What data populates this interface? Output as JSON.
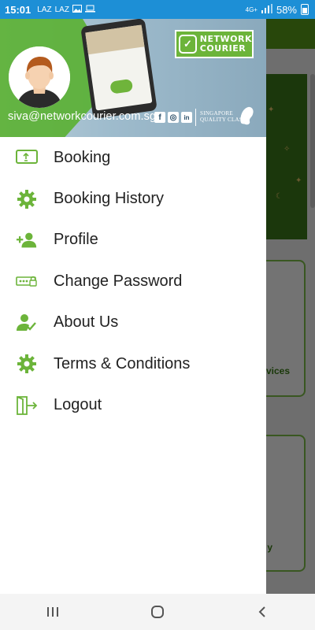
{
  "status_bar": {
    "time": "15:01",
    "notifications": [
      "LAZ",
      "LAZ"
    ],
    "network": "4G+",
    "battery": "58%"
  },
  "drawer": {
    "email": "siva@networkcourier.com.sg",
    "brand_line1": "NETWORK",
    "brand_line2": "COURIER",
    "quality_line1": "SINGAPORE",
    "quality_line2": "QUALITY CLASS",
    "social": {
      "facebook": "f",
      "instagram": "◎",
      "linkedin": "in"
    },
    "menu": [
      {
        "label": "Booking",
        "icon": "booking-icon"
      },
      {
        "label": "Booking History",
        "icon": "gear-icon"
      },
      {
        "label": "Profile",
        "icon": "add-person-icon"
      },
      {
        "label": "Change Password",
        "icon": "password-icon"
      },
      {
        "label": "About Us",
        "icon": "verified-person-icon"
      },
      {
        "label": "Terms & Conditions",
        "icon": "gear-icon"
      },
      {
        "label": "Logout",
        "icon": "logout-icon"
      }
    ]
  },
  "background": {
    "card1_text": "vices",
    "card2_text": "y"
  },
  "colors": {
    "accent_green": "#6cb43a",
    "status_bar": "#1d8fd6"
  }
}
